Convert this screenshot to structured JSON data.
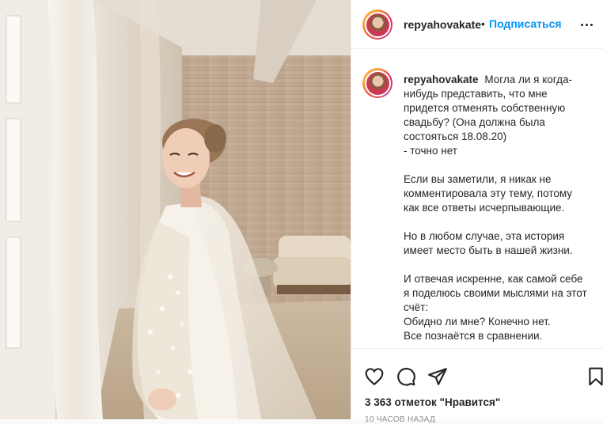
{
  "post": {
    "image_alt": "Bride in wedding dress and veil",
    "header": {
      "username": "repyahovakate",
      "separator": "•",
      "follow_label": "Подписаться"
    },
    "caption": {
      "username": "repyahovakate",
      "paragraphs": [
        [
          "Могла ли я когда-",
          "нибудь представить, что мне",
          "придется отменять собственную",
          "свадьбу? (Она должна была",
          "состояться 18.08.20)",
          "- точно нет"
        ],
        [
          "Если вы заметили, я никак не",
          "комментировала эту тему, потому",
          "как все ответы исчерпывающие."
        ],
        [
          "Но в любом случае, эта история",
          "имеет место быть в нашей жизни."
        ],
        [
          "И отвечая искренне, как самой себе",
          "я поделюсь своими мыслями на этот",
          "счёт:",
          "Обидно ли мне? Конечно нет.",
          "Все познаётся в сравнении."
        ]
      ]
    },
    "icons": [
      "heart-icon",
      "comment-icon",
      "share-icon",
      "bookmark-icon",
      "more-options-icon"
    ],
    "likes_text": "3 363 отметок \"Нравится\"",
    "time_text": "10 часов назад"
  }
}
